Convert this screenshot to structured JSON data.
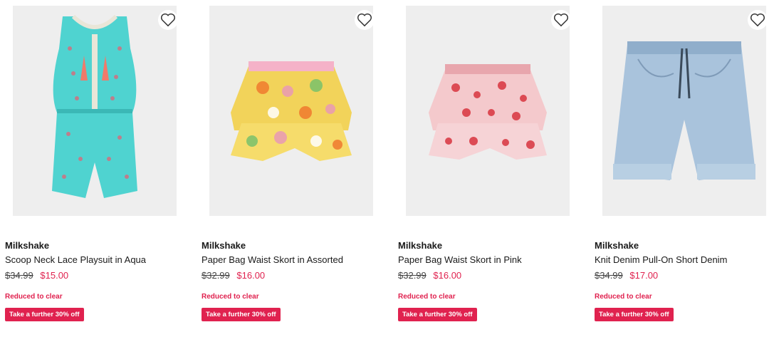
{
  "products": [
    {
      "brand": "Milkshake",
      "name": "Scoop Neck Lace Playsuit in Aqua",
      "was_price": "$34.99",
      "now_price": "$15.00",
      "status": "Reduced to clear",
      "promo": "Take a further 30% off",
      "image": "aqua-playsuit-image",
      "colors": {
        "main": "#4fd3d0",
        "accent": "#f07a6a"
      }
    },
    {
      "brand": "Milkshake",
      "name": "Paper Bag Waist Skort in Assorted",
      "was_price": "$32.99",
      "now_price": "$16.00",
      "status": "Reduced to clear",
      "promo": "Take a further 30% off",
      "image": "floral-skort-image",
      "colors": {
        "main": "#f2d35a",
        "accent": "#e99ab5"
      }
    },
    {
      "brand": "Milkshake",
      "name": "Paper Bag Waist Skort in Pink",
      "was_price": "$32.99",
      "now_price": "$16.00",
      "status": "Reduced to clear",
      "promo": "Take a further 30% off",
      "image": "pink-skort-image",
      "colors": {
        "main": "#f4c9cc",
        "accent": "#d8343f"
      }
    },
    {
      "brand": "Milkshake",
      "name": "Knit Denim Pull-On Short Denim",
      "was_price": "$34.99",
      "now_price": "$17.00",
      "status": "Reduced to clear",
      "promo": "Take a further 30% off",
      "image": "denim-short-image",
      "colors": {
        "main": "#a9c3dc",
        "accent": "#3a4a5a"
      }
    }
  ],
  "theme": {
    "sale_color": "#e0224f",
    "image_bg": "#eeeeee"
  },
  "icons": {
    "wishlist": "heart-outline-icon"
  }
}
